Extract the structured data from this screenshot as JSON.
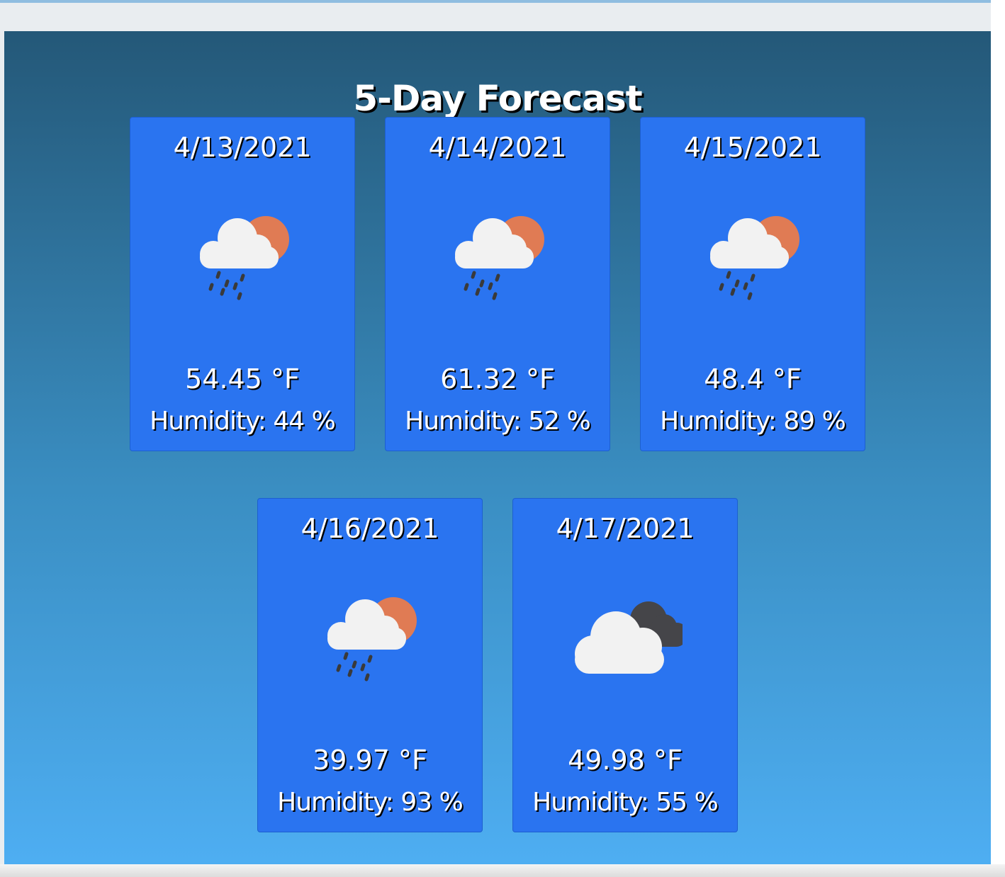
{
  "forecast": {
    "title": "5-Day Forecast",
    "days": [
      {
        "date": "4/13/2021",
        "icon": "rain-sun-icon",
        "temp": "54.45 °F",
        "humidity": "Humidity: 44 %"
      },
      {
        "date": "4/14/2021",
        "icon": "rain-sun-icon",
        "temp": "61.32 °F",
        "humidity": "Humidity: 52 %"
      },
      {
        "date": "4/15/2021",
        "icon": "rain-sun-icon",
        "temp": "48.4 °F",
        "humidity": "Humidity: 89 %"
      },
      {
        "date": "4/16/2021",
        "icon": "rain-sun-icon",
        "temp": "39.97 °F",
        "humidity": "Humidity: 93 %"
      },
      {
        "date": "4/17/2021",
        "icon": "broken-clouds-icon",
        "temp": "49.98 °F",
        "humidity": "Humidity: 55 %"
      }
    ]
  },
  "colors": {
    "card_background": "#2a74f0",
    "sun": "#e07b54",
    "cloud": "#f2f2f2",
    "dark_cloud": "#454549",
    "rain_drops": "#3a3a3a"
  }
}
